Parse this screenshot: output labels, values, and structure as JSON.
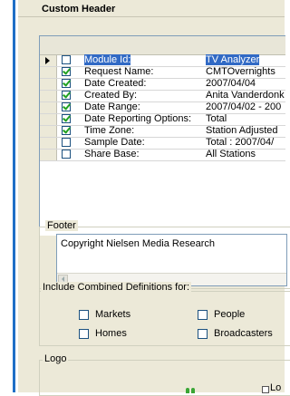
{
  "header": {
    "title": "Custom Header"
  },
  "grid": {
    "rows": [
      {
        "checked": false,
        "selected": true,
        "key": "Module Id:",
        "value": "TV Analyzer"
      },
      {
        "checked": true,
        "selected": false,
        "key": "Request Name:",
        "value": "CMTOvernights"
      },
      {
        "checked": true,
        "selected": false,
        "key": "Date Created:",
        "value": "2007/04/04"
      },
      {
        "checked": true,
        "selected": false,
        "key": "Created By:",
        "value": "Anita Vanderdonk"
      },
      {
        "checked": true,
        "selected": false,
        "key": "Date Range:",
        "value": "2007/04/02 - 200"
      },
      {
        "checked": true,
        "selected": false,
        "key": "Date Reporting Options:",
        "value": "Total"
      },
      {
        "checked": true,
        "selected": false,
        "key": "Time Zone:",
        "value": "Station Adjusted"
      },
      {
        "checked": false,
        "selected": false,
        "key": "Sample Date:",
        "value": "Total  :  2007/04/"
      },
      {
        "checked": false,
        "selected": false,
        "key": "Share Base:",
        "value": "All Stations"
      }
    ]
  },
  "footer": {
    "label": "Footer",
    "text": "Copyright Nielsen Media Research"
  },
  "combined": {
    "label": "Include Combined Definitions for:",
    "options": {
      "markets": "Markets",
      "people": "People",
      "homes": "Homes",
      "broadcasters": "Broadcasters"
    }
  },
  "logo": {
    "label": "Logo",
    "side_label": "Lo"
  }
}
